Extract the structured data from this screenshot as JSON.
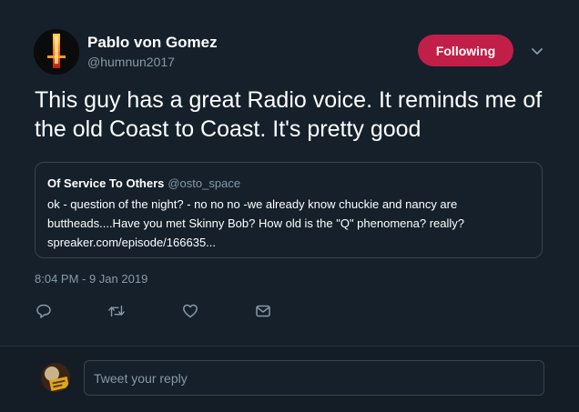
{
  "author": {
    "name": "Pablo von Gomez",
    "handle": "@humnun2017"
  },
  "follow_button": {
    "label": "Following",
    "color": "#c21f48"
  },
  "tweet": {
    "text": "This guy has a great Radio voice. It reminds me of the old Coast to Coast. It's pretty good",
    "timestamp": "8:04 PM - 9 Jan 2019"
  },
  "quoted_tweet": {
    "name": "Of Service To Others",
    "handle": "@osto_space",
    "text": "ok - question of the night? - no no  no -we already know chuckie and nancy are buttheads....Have you met Skinny Bob? How old is the \"Q\" phenomena? really?",
    "link": "spreaker.com/episode/166635..."
  },
  "actions": [
    {
      "icon": "reply-icon"
    },
    {
      "icon": "retweet-icon"
    },
    {
      "icon": "like-icon"
    },
    {
      "icon": "direct-message-icon"
    }
  ],
  "reply": {
    "placeholder": "Tweet your reply"
  },
  "colors": {
    "background": "#15202b",
    "text_secondary": "#8899a6",
    "border": "#38444d"
  }
}
